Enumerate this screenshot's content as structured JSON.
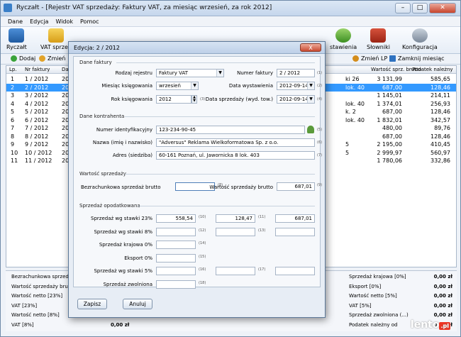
{
  "window": {
    "title": "Ryczałt - [Rejestr VAT sprzedaży: Faktury VAT, za miesiąc wrzesień, za rok 2012]"
  },
  "menu": [
    "Dane",
    "Edycja",
    "Widok",
    "Pomoc"
  ],
  "ribbon": {
    "left": [
      "Ryczałt",
      "VAT sprzed"
    ],
    "right": [
      "stawienia",
      "Słowniki",
      "Konfiguracja"
    ]
  },
  "toolbar": {
    "add": "Dodaj",
    "change": "Zmień",
    "change_lp": "Zmień LP",
    "close_month": "Zamknij miesiąc"
  },
  "grid": {
    "headers": {
      "lp": "Lp.",
      "nr": "Nr faktury",
      "dat": "Dat",
      "brutto": "Wartość sprz. brutto",
      "podatek": "Podatek należny"
    },
    "rows": [
      {
        "lp": "1",
        "nr": "1 / 2012",
        "dat": "20",
        "mid": "ki 26",
        "brutto": "3 131,99",
        "podatek": "585,65"
      },
      {
        "lp": "2",
        "nr": "2 / 2012",
        "dat": "20",
        "mid": "lok. 40",
        "brutto": "687,00",
        "podatek": "128,46"
      },
      {
        "lp": "3",
        "nr": "3 / 2012",
        "dat": "20",
        "mid": "",
        "brutto": "1 145,01",
        "podatek": "214,11"
      },
      {
        "lp": "4",
        "nr": "4 / 2012",
        "dat": "20",
        "mid": "lok. 40",
        "brutto": "1 374,01",
        "podatek": "256,93"
      },
      {
        "lp": "5",
        "nr": "5 / 2012",
        "dat": "20",
        "mid": "k. 2",
        "brutto": "687,00",
        "podatek": "128,46"
      },
      {
        "lp": "6",
        "nr": "6 / 2012",
        "dat": "20",
        "mid": "lok. 40",
        "brutto": "1 832,01",
        "podatek": "342,57"
      },
      {
        "lp": "7",
        "nr": "7 / 2012",
        "dat": "20",
        "mid": "",
        "brutto": "480,00",
        "podatek": "89,76"
      },
      {
        "lp": "8",
        "nr": "8 / 2012",
        "dat": "20",
        "mid": "",
        "brutto": "687,00",
        "podatek": "128,46"
      },
      {
        "lp": "9",
        "nr": "9 / 2012",
        "dat": "20",
        "mid": "5",
        "brutto": "2 195,00",
        "podatek": "410,45"
      },
      {
        "lp": "10",
        "nr": "10 / 2012",
        "dat": "20",
        "mid": "5",
        "brutto": "2 999,97",
        "podatek": "560,97"
      },
      {
        "lp": "11",
        "nr": "11 / 2012",
        "dat": "20",
        "mid": "",
        "brutto": "1 780,06",
        "podatek": "332,86"
      }
    ]
  },
  "summary_left": [
    {
      "label": "Bezrachunkowa sprzedaż",
      "value": ""
    },
    {
      "label": "Wartość sprzedaży brutto",
      "value": ""
    },
    {
      "label": "Wartość netto [23%]",
      "value": ""
    },
    {
      "label": "VAT [23%]",
      "value": ""
    },
    {
      "label": "Wartość netto [8%]",
      "value": ""
    },
    {
      "label": "VAT [8%]",
      "value": "0,00 zł"
    }
  ],
  "summary_right": [
    {
      "label": "Sprzedaż krajowa [0%]",
      "value": "0,00 zł"
    },
    {
      "label": "Eksport [0%]",
      "value": "0,00 zł"
    },
    {
      "label": "Wartość netto [5%]",
      "value": "0,00 zł"
    },
    {
      "label": "VAT [5%]",
      "value": "0,00 zł"
    },
    {
      "label": "Sprzedaż zwolniona (...)",
      "value": "0,00 zł"
    },
    {
      "label": "Podatek należny od",
      "value": "0,00 zł"
    }
  ],
  "watermark": {
    "text": "lento",
    "tld": ".pl"
  },
  "dialog": {
    "title": "Edycja: 2 / 2012",
    "close": "X",
    "sections": {
      "faktura": "Dane faktury",
      "kontrahent": "Dane kontrahenta",
      "wartosc": "Wartość sprzedaży",
      "opodatkowana": "Sprzedaż opodatkowana"
    },
    "faktura": {
      "rodzaj_label": "Rodzaj rejestru",
      "rodzaj_value": "Faktury VAT",
      "nr_label": "Numer faktury",
      "nr_value": "2 / 2012",
      "nr_hint": "(1)",
      "miesiac_label": "Miesiąc księgowania",
      "miesiac_value": "wrzesień",
      "data_wyst_label": "Data wystawienia",
      "data_wyst_value": "2012-09-14",
      "data_wyst_hint": "(2)",
      "rok_label": "Rok księgowania",
      "rok_value": "2012",
      "rok_hint": "(3)",
      "data_sprz_label": "Data sprzedaży (wyd. tow.)",
      "data_sprz_value": "2012-09-14",
      "data_sprz_hint": "(4)"
    },
    "kontrahent": {
      "nip_label": "Numer identyfikacyjny",
      "nip_value": "123-234-90-45",
      "nip_hint": "(5)",
      "nazwa_label": "Nazwa (imię i nazwisko)",
      "nazwa_value": "\"Adversus\" Reklama Wielkoformatowa Sp. z o.o.",
      "nazwa_hint": "(6)",
      "adres_label": "Adres (siedziba)",
      "adres_value": "60-161  Poznań, ul. Jawornicka 8 lok. 403",
      "adres_hint": "(7)"
    },
    "wartosc": {
      "bezrach_label": "Bezrachunkowa sprzedaż brutto",
      "bezrach_value": "",
      "bezrach_hint": "(8)",
      "brutto_label": "Wartość sprzedaży brutto",
      "brutto_value": "687,01",
      "brutto_hint": "(9)"
    },
    "opodatkowana": [
      {
        "label": "Sprzedaż wg stawki 23%",
        "h1": "(10)",
        "v1": "558,54",
        "h2": "(11)",
        "v2": "128,47",
        "v3": "687,01"
      },
      {
        "label": "Sprzedaż wg stawki 8%",
        "h1": "(12)",
        "v1": "",
        "h2": "(13)",
        "v2": "",
        "v3": ""
      },
      {
        "label": "Sprzedaż krajowa 0%",
        "h1": "(14)",
        "v1": ""
      },
      {
        "label": "Eksport 0%",
        "h1": "(15)",
        "v1": ""
      },
      {
        "label": "Sprzedaż wg stawki 5%",
        "h1": "(16)",
        "v1": "",
        "h2": "(17)",
        "v2": "",
        "v3": ""
      },
      {
        "label": "Sprzedaż zwolniona",
        "h1": "(18)",
        "v1": ""
      }
    ],
    "buttons": {
      "save": "Zapisz",
      "cancel": "Anuluj"
    }
  }
}
